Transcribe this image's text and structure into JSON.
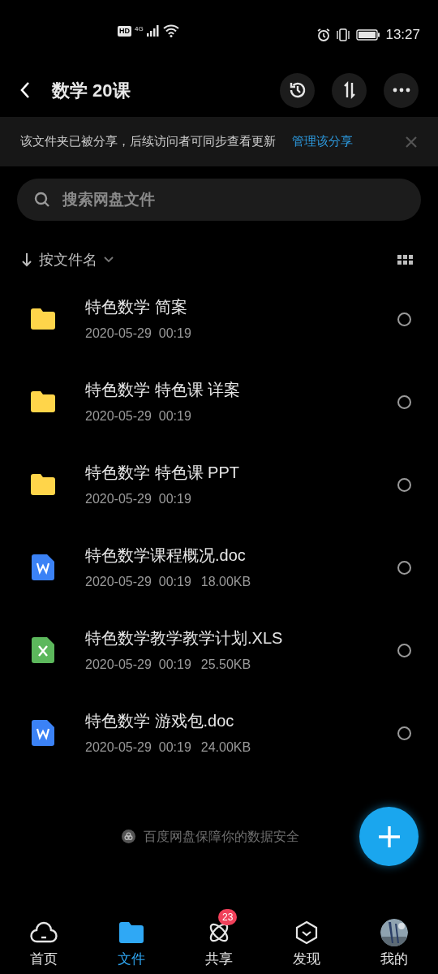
{
  "status_bar": {
    "hd": "HD",
    "network": "4G",
    "time": "13:27"
  },
  "header": {
    "title": "数学 20课"
  },
  "share_notice": {
    "text": "该文件夹已被分享，后续访问者可同步查看更新",
    "link": "管理该分享"
  },
  "search": {
    "placeholder": "搜索网盘文件"
  },
  "sort": {
    "label": "按文件名"
  },
  "files": [
    {
      "kind": "folder",
      "name": "特色数学 简案",
      "date": "2020-05-29  00:19",
      "selected": false
    },
    {
      "kind": "folder",
      "name": "特色数学 特色课 详案",
      "date": "2020-05-29  00:19",
      "selected": false
    },
    {
      "kind": "folder",
      "name": "特色数学 特色课 PPT",
      "date": "2020-05-29  00:19",
      "selected": false
    },
    {
      "kind": "word",
      "name": "特色数学课程概况.doc",
      "date": "2020-05-29  00:19",
      "size": "18.00KB",
      "selected": false
    },
    {
      "kind": "excel",
      "name": "特色数学教学教学计划.XLS",
      "date": "2020-05-29  00:19",
      "size": "25.50KB",
      "selected": false
    },
    {
      "kind": "word",
      "name": "特色数学 游戏包.doc",
      "date": "2020-05-29  00:19",
      "size": "24.00KB",
      "selected": false
    }
  ],
  "footer_note": "百度网盘保障你的数据安全",
  "nav": [
    {
      "kind": "home",
      "label": "首页",
      "selected": false
    },
    {
      "kind": "files",
      "label": "文件",
      "selected": true
    },
    {
      "kind": "share",
      "label": "共享",
      "selected": false,
      "badge": "23"
    },
    {
      "kind": "discover",
      "label": "发现",
      "selected": false
    },
    {
      "kind": "avatar",
      "label": "我的",
      "selected": false
    }
  ]
}
